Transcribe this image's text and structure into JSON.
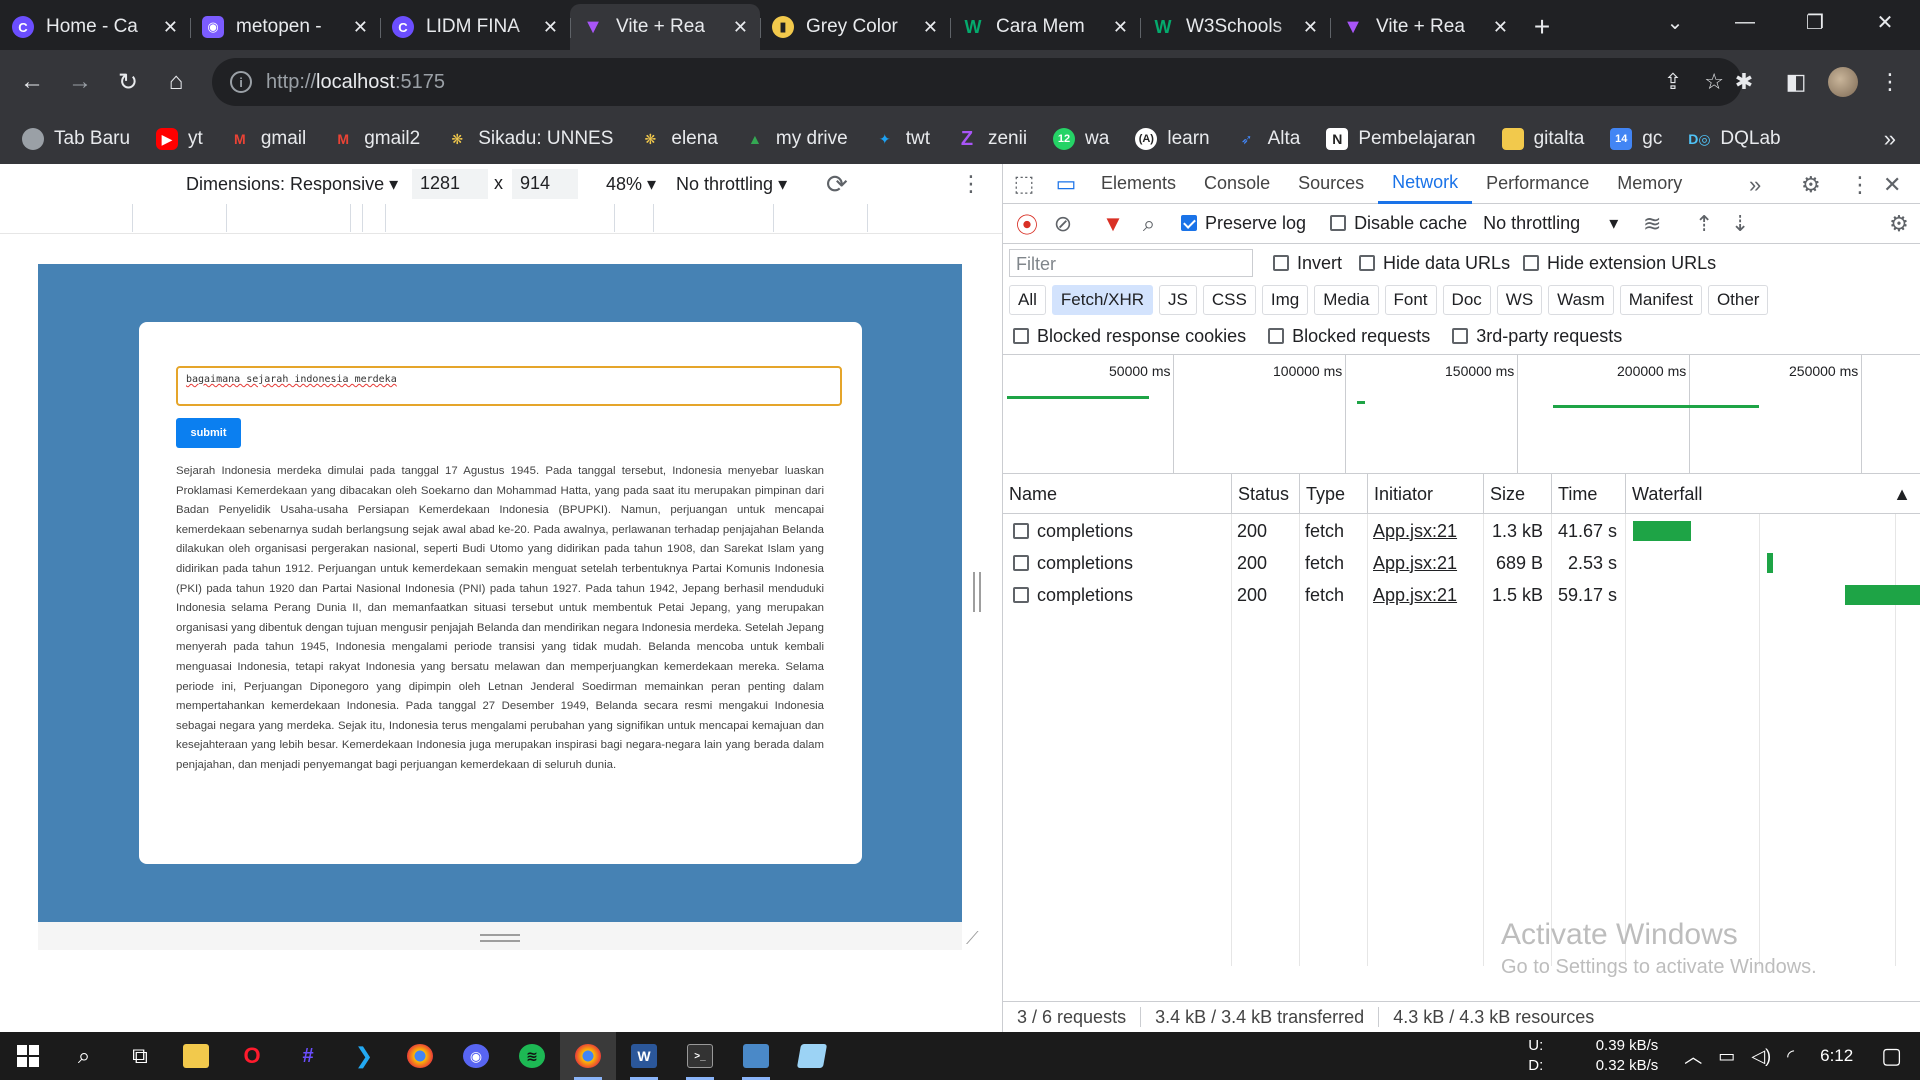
{
  "browser": {
    "tabs": [
      {
        "title": "Home - Ca",
        "icon": "c-logo-icon",
        "color": "#6b4eff"
      },
      {
        "title": "metopen -",
        "icon": "metopen-icon",
        "color": "#7b5cff"
      },
      {
        "title": "LIDM FINA",
        "icon": "c-logo-icon",
        "color": "#6b4eff"
      },
      {
        "title": "Vite + Rea",
        "icon": "vite-icon",
        "color": "#a855f7",
        "active": true
      },
      {
        "title": "Grey Color",
        "icon": "color-icon",
        "color": "#f2c94c"
      },
      {
        "title": "Cara Mem",
        "icon": "w-icon",
        "color": "#04aa6d"
      },
      {
        "title": "W3Schools",
        "icon": "w3-icon",
        "color": "#04aa6d"
      },
      {
        "title": "Vite + Rea",
        "icon": "vite-icon",
        "color": "#a855f7"
      }
    ],
    "url_scheme": "http://",
    "url_host": "localhost",
    "url_port": ":5175",
    "bookmarks": [
      {
        "label": "Tab Baru",
        "color": "#9aa0a6",
        "icon": "globe-icon"
      },
      {
        "label": "yt",
        "color": "#ff0000",
        "icon": "youtube-icon"
      },
      {
        "label": "gmail",
        "color": "#ea4335",
        "icon": "gmail-icon"
      },
      {
        "label": "gmail2",
        "color": "#ea4335",
        "icon": "gmail-icon"
      },
      {
        "label": "Sikadu: UNNES",
        "color": "#f2c94c",
        "icon": "unnes-icon"
      },
      {
        "label": "elena",
        "color": "#f2c94c",
        "icon": "unnes-icon"
      },
      {
        "label": "my drive",
        "color": "#34a853",
        "icon": "drive-icon"
      },
      {
        "label": "twt",
        "color": "#1da1f2",
        "icon": "twitter-icon"
      },
      {
        "label": "zenii",
        "color": "#a855f7",
        "icon": "z-icon"
      },
      {
        "label": "wa",
        "color": "#25d366",
        "icon": "whatsapp-icon"
      },
      {
        "label": "learn",
        "color": "#ffffff",
        "icon": "a-icon"
      },
      {
        "label": "Alta",
        "color": "#4285f4",
        "icon": "alta-icon"
      },
      {
        "label": "Pembelajaran",
        "color": "#ffffff",
        "icon": "notion-icon"
      },
      {
        "label": "gitalta",
        "color": "#f2c94c",
        "icon": "folder-icon"
      },
      {
        "label": "gc",
        "color": "#4285f4",
        "icon": "classroom-icon"
      },
      {
        "label": "DQLab",
        "color": "#4fc3f7",
        "icon": "dqlab-icon"
      }
    ]
  },
  "device_toolbar": {
    "dimensions": "Dimensions: Responsive",
    "width": "1281",
    "x": "x",
    "height": "914",
    "zoom": "48%",
    "throttling": "No throttling"
  },
  "app": {
    "query": "bagaimana sejarah indonesia merdeka",
    "submit_label": "submit",
    "answer": "Sejarah Indonesia merdeka dimulai pada tanggal 17 Agustus 1945. Pada tanggal tersebut, Indonesia menyebar luaskan Proklamasi Kemerdekaan yang dibacakan oleh Soekarno dan Mohammad Hatta, yang pada saat itu merupakan pimpinan dari Badan Penyelidik Usaha-usaha Persiapan Kemerdekaan Indonesia (BPUPKI). Namun, perjuangan untuk mencapai kemerdekaan sebenarnya sudah berlangsung sejak awal abad ke-20. Pada awalnya, perlawanan terhadap penjajahan Belanda dilakukan oleh organisasi pergerakan nasional, seperti Budi Utomo yang didirikan pada tahun 1908, dan Sarekat Islam yang didirikan pada tahun 1912. Perjuangan untuk kemerdekaan semakin menguat setelah terbentuknya Partai Komunis Indonesia (PKI) pada tahun 1920 dan Partai Nasional Indonesia (PNI) pada tahun 1927. Pada tahun 1942, Jepang berhasil menduduki Indonesia selama Perang Dunia II, dan memanfaatkan situasi tersebut untuk membentuk Petai Jepang, yang merupakan organisasi yang dibentuk dengan tujuan mengusir penjajah Belanda dan mendirikan negara Indonesia merdeka. Setelah Jepang menyerah pada tahun 1945, Indonesia mengalami periode transisi yang tidak mudah. Belanda mencoba untuk kembali menguasai Indonesia, tetapi rakyat Indonesia yang bersatu melawan dan memperjuangkan kemerdekaan mereka. Selama periode ini, Perjuangan Diponegoro yang dipimpin oleh Letnan Jenderal Soedirman memainkan peran penting dalam mempertahankan kemerdekaan Indonesia. Pada tanggal 27 Desember 1949, Belanda secara resmi mengakui Indonesia sebagai negara yang merdeka. Sejak itu, Indonesia terus mengalami perubahan yang signifikan untuk mencapai kemajuan dan kesejahteraan yang lebih besar. Kemerdekaan Indonesia juga merupakan inspirasi bagi negara-negara lain yang berada dalam penjajahan, dan menjadi penyemangat bagi perjuangan kemerdekaan di seluruh dunia."
  },
  "devtools": {
    "tabs": [
      "Elements",
      "Console",
      "Sources",
      "Network",
      "Performance",
      "Memory"
    ],
    "active_tab": "Network",
    "preserve_log": "Preserve log",
    "disable_cache": "Disable cache",
    "throttling": "No throttling",
    "filter_placeholder": "Filter",
    "invert": "Invert",
    "hide_data_urls": "Hide data URLs",
    "hide_extension_urls": "Hide extension URLs",
    "types": [
      "All",
      "Fetch/XHR",
      "JS",
      "CSS",
      "Img",
      "Media",
      "Font",
      "Doc",
      "WS",
      "Wasm",
      "Manifest",
      "Other"
    ],
    "selected_type": "Fetch/XHR",
    "blocked_cookies": "Blocked response cookies",
    "blocked_requests": "Blocked requests",
    "third_party": "3rd-party requests",
    "overview_ticks": [
      "50000 ms",
      "100000 ms",
      "150000 ms",
      "200000 ms",
      "250000 ms"
    ],
    "columns": [
      "Name",
      "Status",
      "Type",
      "Initiator",
      "Size",
      "Time",
      "Waterfall"
    ],
    "rows": [
      {
        "name": "completions",
        "status": "200",
        "type": "fetch",
        "initiator": "App.jsx:21",
        "size": "1.3 kB",
        "time": "41.67 s"
      },
      {
        "name": "completions",
        "status": "200",
        "type": "fetch",
        "initiator": "App.jsx:21",
        "size": "689 B",
        "time": "2.53 s"
      },
      {
        "name": "completions",
        "status": "200",
        "type": "fetch",
        "initiator": "App.jsx:21",
        "size": "1.5 kB",
        "time": "59.17 s"
      }
    ],
    "status_requests": "3 / 6 requests",
    "status_transferred": "3.4 kB / 3.4 kB transferred",
    "status_resources": "4.3 kB / 4.3 kB resources",
    "activate_title": "Activate Windows",
    "activate_sub": "Go to Settings to activate Windows."
  },
  "taskbar": {
    "net_up_label": "U:",
    "net_up": "0.39 kB/s",
    "net_down_label": "D:",
    "net_down": "0.32 kB/s",
    "clock": "6:12"
  }
}
